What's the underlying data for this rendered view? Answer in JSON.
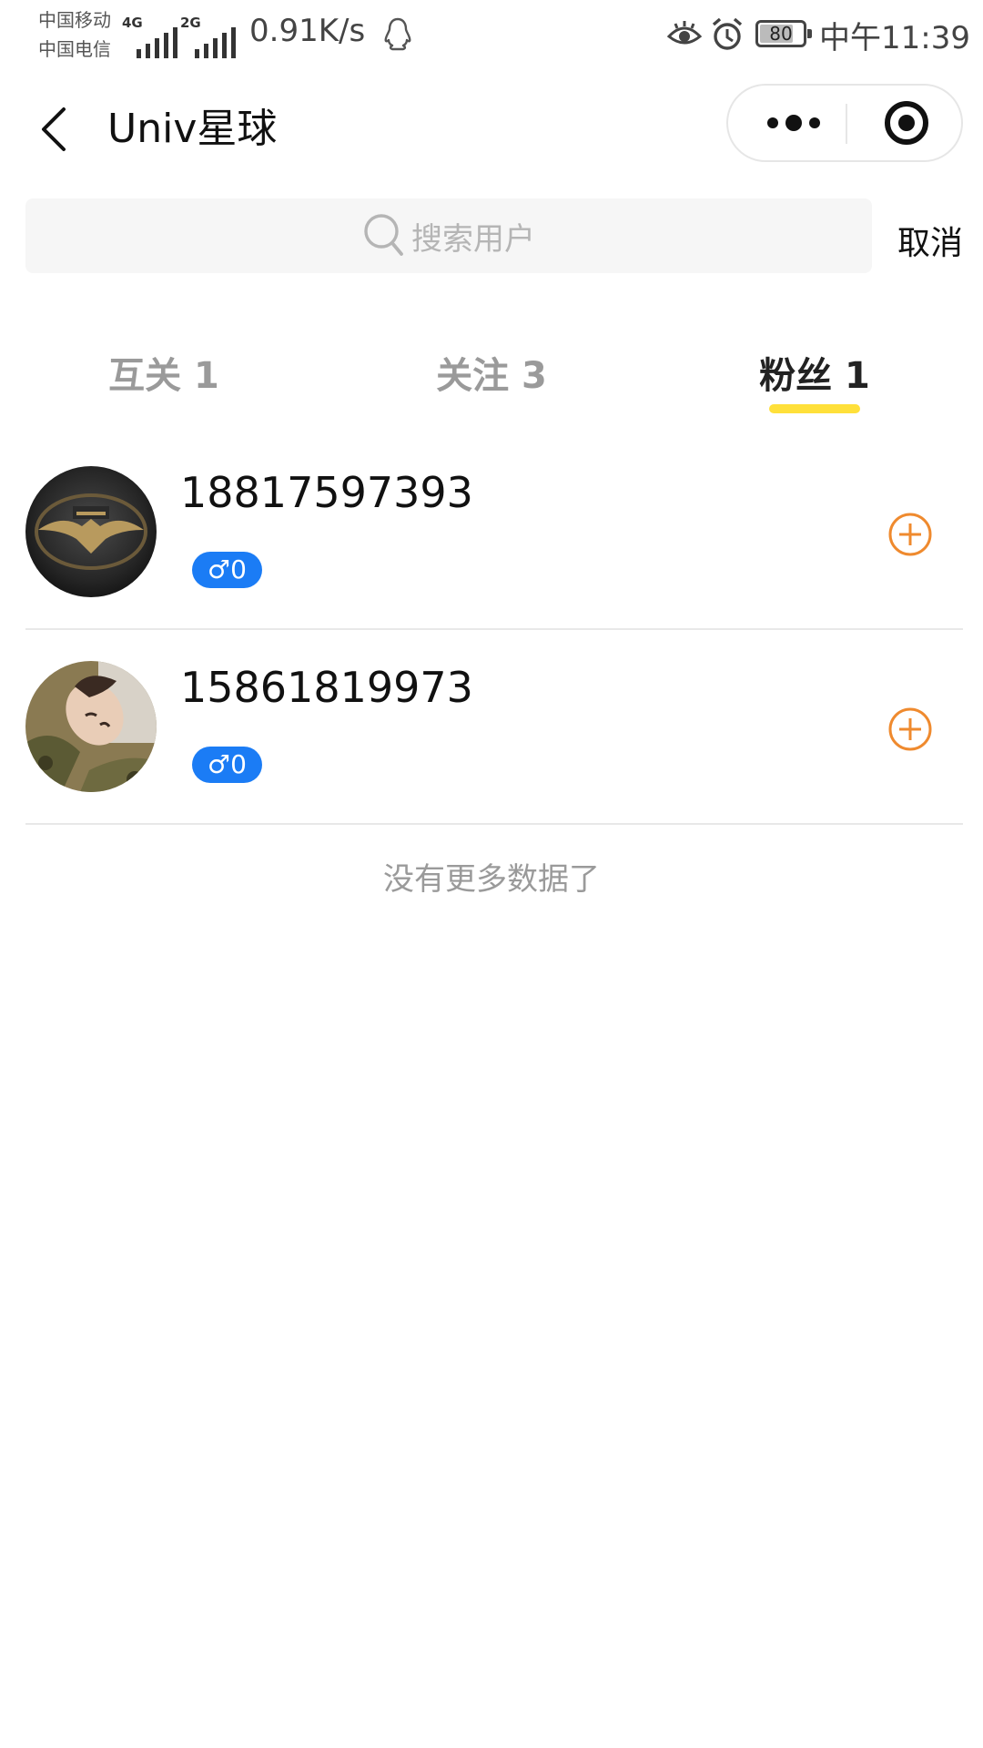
{
  "status_bar": {
    "carrier_1": "中国移动",
    "carrier_2": "中国电信",
    "sim1_tag": "4G",
    "sim2_tag": "2G",
    "net_speed": "0.91K/s",
    "battery_level": 80,
    "battery_text": "80",
    "time": "中午11:39",
    "icons": [
      "qq-penguin-icon",
      "eye-icon",
      "alarm-icon",
      "battery-icon"
    ]
  },
  "navbar": {
    "title": "Univ星球",
    "icons": [
      "back-arrow-icon",
      "more-dots-icon",
      "target-icon"
    ]
  },
  "search": {
    "placeholder": "搜索用户",
    "cancel_label": "取消"
  },
  "tabs": {
    "items": [
      {
        "label": "互关 1"
      },
      {
        "label": "关注 3"
      },
      {
        "label": "粉丝 1"
      }
    ],
    "active_index": 2
  },
  "users": [
    {
      "name": "18817597393",
      "gender_badge": "♂0"
    },
    {
      "name": "15861819973",
      "gender_badge": "♂0"
    }
  ],
  "footer_text": "没有更多数据了",
  "colors": {
    "accent_yellow": "#ffe03a",
    "gender_blue": "#1b7cf5",
    "follow_orange": "#ef8a2e",
    "muted_text": "#9a9a9a"
  }
}
